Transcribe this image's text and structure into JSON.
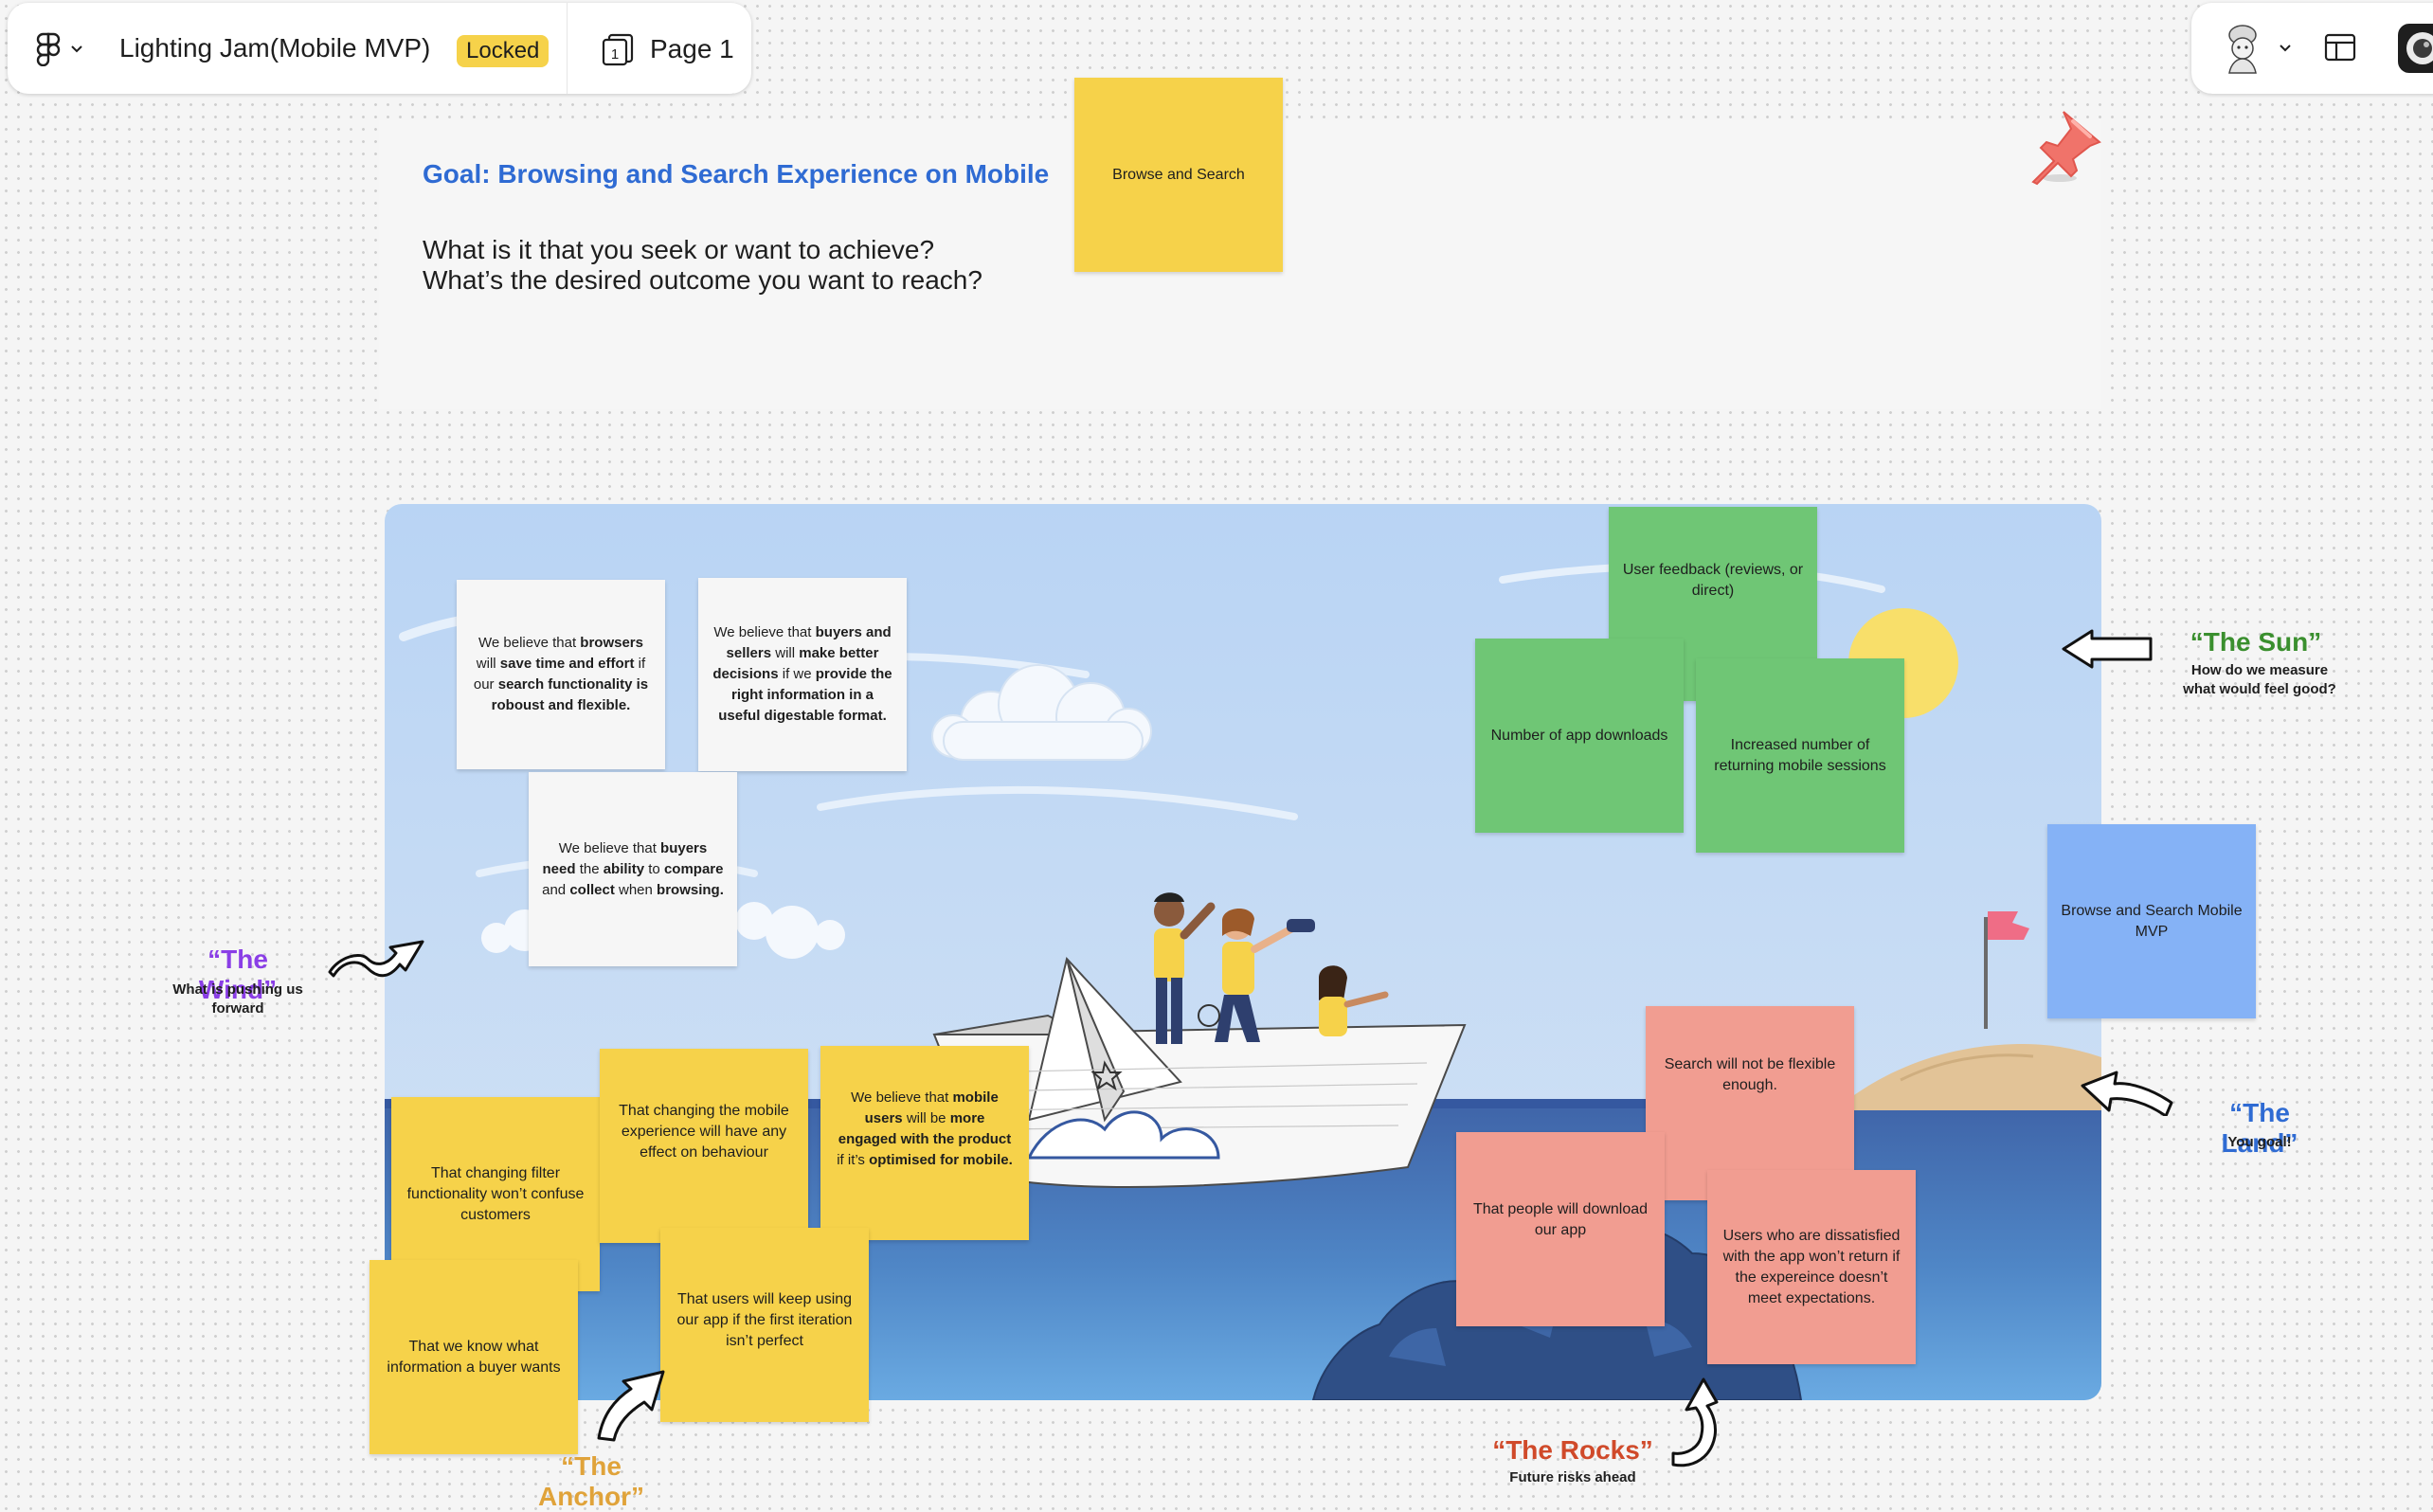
{
  "toolbar": {
    "file_title": "Lighting Jam(Mobile MVP)",
    "status_badge": "Locked",
    "page_number_icon": "1",
    "page_label": "Page 1"
  },
  "goal": {
    "title": "Goal: Browsing and Search Experience on Mobile",
    "question_line1": "What is it that you seek or want to achieve?",
    "question_line2": "What’s the desired outcome you want to reach?",
    "sticky": "Browse and Search"
  },
  "wind": {
    "title": "“The Wind”",
    "subtitle_line1": "What is pushing us",
    "subtitle_line2": "forward",
    "notes": [
      {
        "pre": "We believe that ",
        "b1": "browsers",
        "mid1": " will ",
        "b2": "save time and effort",
        "mid2": " if our ",
        "b3": "search functionality is roboust and flexible."
      },
      {
        "pre": "We believe that ",
        "b1": "buyers and sellers",
        "mid1": " will ",
        "b2": "make better decisions",
        "mid2": " if we ",
        "b3": "provide the right information in a useful digestable format."
      },
      {
        "pre": "We believe that ",
        "b1": "buyers need",
        "mid1": " the ",
        "b2": "ability",
        "mid2": " to ",
        "b3": "compare",
        "mid3": " and ",
        "b4": "collect",
        "post": " when ",
        "b5": "browsing."
      }
    ]
  },
  "sun": {
    "title": "“The Sun”",
    "subtitle_line1": "How do we measure",
    "subtitle_line2": "what would feel good?",
    "notes": [
      "User feedback (reviews, or direct)",
      "Number of app downloads",
      "Increased number of returning mobile sessions"
    ]
  },
  "land": {
    "title": "“The Land”",
    "subtitle": "You goal!",
    "note": "Browse and Search Mobile MVP"
  },
  "anchor": {
    "title": "“The Anchor”",
    "notes": [
      "That changing filter functionality won’t confuse customers",
      "That changing the mobile experience will have any effect on behaviour",
      "That we know what information a buyer wants",
      "That users will keep using our app if the first iteration isn’t perfect"
    ],
    "engaged_note": {
      "pre": "We believe that ",
      "b1": "mobile users",
      "mid1": " will be ",
      "b2": "more engaged with the product",
      "mid2": " if it’s ",
      "b3": "optimised for mobile."
    }
  },
  "rocks": {
    "title": "“The Rocks”",
    "subtitle": "Future risks ahead",
    "notes": [
      "Search will not be flexible enough.",
      "That people will download our app",
      "Users who are dissatisfied with the app won’t return if the expereince doesn’t meet expectations."
    ]
  },
  "colors": {
    "wind": "#8a3ee6",
    "sun": "#3a8f2e",
    "land": "#2f6bd3",
    "anchor": "#e0a33a",
    "rocks": "#d04a2a",
    "yellow_sticky": "#f6d24a",
    "green_sticky": "#6fc675",
    "blue_sticky": "#85b2f6",
    "pink_sticky": "#f19d91"
  },
  "icons": [
    "figma-logo-icon",
    "chevron-down-icon",
    "page-icon",
    "avatar-icon",
    "layout-panel-icon",
    "user-avatar-icon",
    "pushpin-icon",
    "arrow-icon"
  ]
}
